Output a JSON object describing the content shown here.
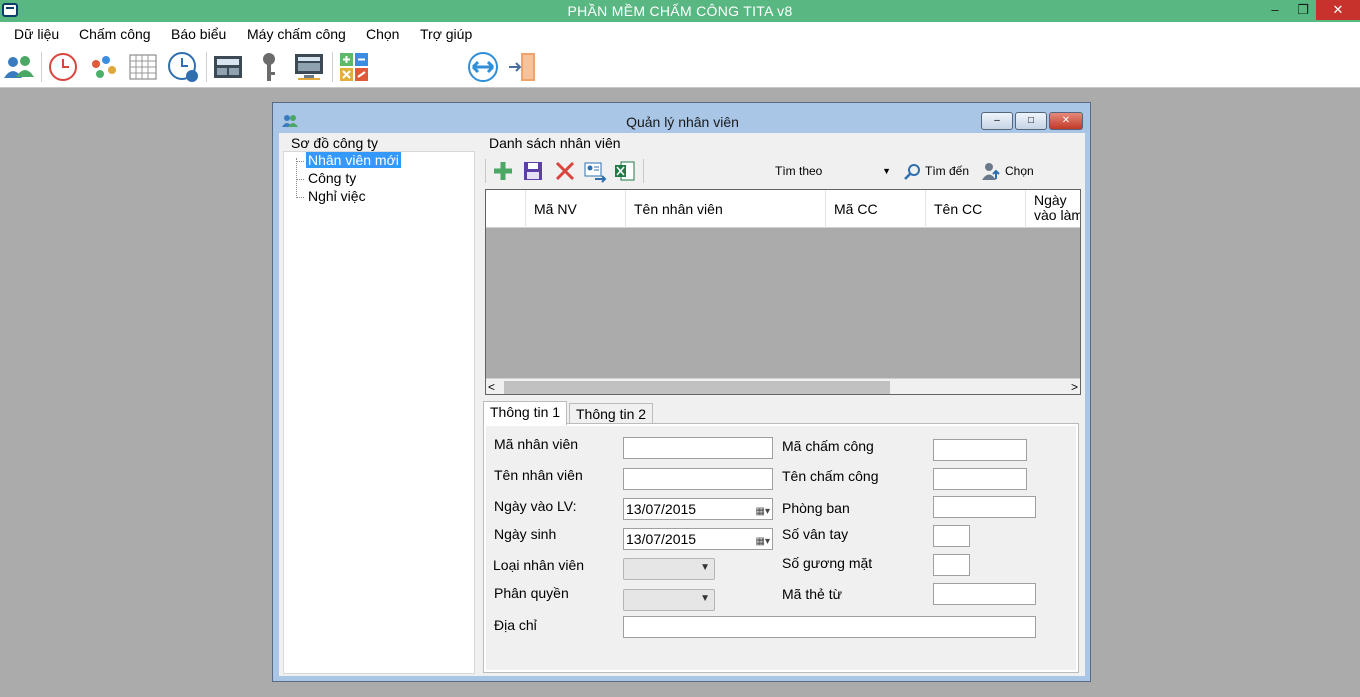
{
  "window": {
    "title": "PHẦN MỀM CHẤM CÔNG TITA v8",
    "min_glyph": "–",
    "restore_glyph": "❐",
    "close_glyph": "✕"
  },
  "menu": [
    "Dữ liệu",
    "Chấm công",
    "Báo biểu",
    "Máy chấm công",
    "Chọn",
    "Trợ giúp"
  ],
  "toolbar_icons": [
    "users-icon",
    "clock-icon",
    "dots-icon",
    "calendar-grid-icon",
    "user-clock-icon",
    "terminal-icon",
    "key-icon",
    "monitor-table-icon",
    "calculator-icon",
    "sync-arrows-icon",
    "exit-door-icon"
  ],
  "dialog": {
    "title": "Quản lý nhân viên",
    "min_glyph": "–",
    "max_glyph": "□",
    "close_glyph": "✕",
    "tree": {
      "label": "Sơ đồ công ty",
      "nodes": [
        "Nhân viên mới",
        "Công ty",
        "Nghỉ việc"
      ]
    },
    "list": {
      "label": "Danh sách nhân viên",
      "search_by": "Tìm theo",
      "find_label": "Tìm đến",
      "choose_label": "Chọn",
      "columns": [
        "Mã NV",
        "Tên nhân viên",
        "Mã CC",
        "Tên CC",
        "Ngày vào làm"
      ],
      "scroll_left": "<",
      "scroll_right": ">",
      "rows": []
    },
    "tabs": [
      "Thông tin 1",
      "Thông tin 2"
    ],
    "form": {
      "ma_nv_label": "Mã nhân viên",
      "ma_nv": "",
      "ten_nv_label": "Tên nhân viên",
      "ten_nv": "",
      "ngay_vao_label": "Ngày vào LV:",
      "ngay_vao": "13/07/2015",
      "ngay_sinh_label": "Ngày sinh",
      "ngay_sinh": "13/07/2015",
      "loai_nv_label": "Loại nhân viên",
      "phan_quyen_label": "Phân quyền",
      "dia_chi_label": "Địa chỉ",
      "dia_chi": "",
      "ma_cc_label": "Mã chấm công",
      "ma_cc": "",
      "ten_cc_label": "Tên chấm công",
      "ten_cc": "",
      "phong_ban_label": "Phòng ban",
      "phong_ban": "",
      "so_van_tay_label": "Số vân tay",
      "so_van_tay": "",
      "so_guong_mat_label": "Số gương mặt",
      "so_guong_mat": "",
      "ma_the_tu_label": "Mã thẻ từ",
      "ma_the_tu": ""
    }
  }
}
